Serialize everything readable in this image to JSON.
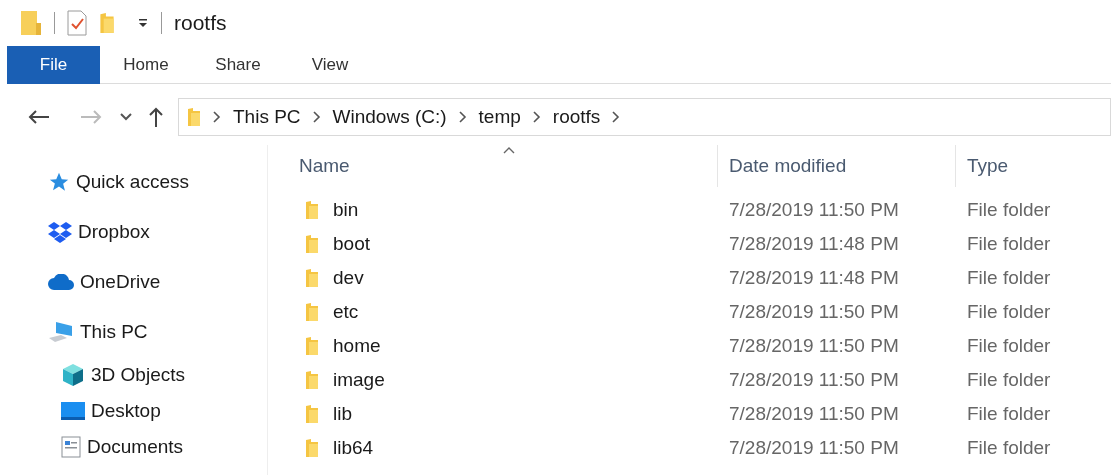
{
  "window": {
    "title": "rootfs"
  },
  "ribbon_tabs": [
    {
      "label": "File",
      "selected": true
    },
    {
      "label": "Home",
      "selected": false
    },
    {
      "label": "Share",
      "selected": false
    },
    {
      "label": "View",
      "selected": false
    }
  ],
  "breadcrumb": [
    "This PC",
    "Windows (C:)",
    "temp",
    "rootfs"
  ],
  "sidebar": {
    "items": [
      {
        "label": "Quick access",
        "kind": "star"
      },
      {
        "label": "Dropbox",
        "kind": "dropbox"
      },
      {
        "label": "OneDrive",
        "kind": "cloud"
      },
      {
        "label": "This PC",
        "kind": "pc",
        "children": [
          {
            "label": "3D Objects",
            "kind": "cube"
          },
          {
            "label": "Desktop",
            "kind": "desktop"
          },
          {
            "label": "Documents",
            "kind": "documents"
          }
        ]
      }
    ]
  },
  "table": {
    "columns": [
      {
        "label": "Name",
        "sorted": true
      },
      {
        "label": "Date modified",
        "sorted": false
      },
      {
        "label": "Type",
        "sorted": false
      }
    ],
    "rows": [
      {
        "name": "bin",
        "date": "7/28/2019 11:50 PM",
        "type": "File folder"
      },
      {
        "name": "boot",
        "date": "7/28/2019 11:48 PM",
        "type": "File folder"
      },
      {
        "name": "dev",
        "date": "7/28/2019 11:48 PM",
        "type": "File folder"
      },
      {
        "name": "etc",
        "date": "7/28/2019 11:50 PM",
        "type": "File folder"
      },
      {
        "name": "home",
        "date": "7/28/2019 11:50 PM",
        "type": "File folder"
      },
      {
        "name": "image",
        "date": "7/28/2019 11:50 PM",
        "type": "File folder"
      },
      {
        "name": "lib",
        "date": "7/28/2019 11:50 PM",
        "type": "File folder"
      },
      {
        "name": "lib64",
        "date": "7/28/2019 11:50 PM",
        "type": "File folder"
      }
    ]
  }
}
